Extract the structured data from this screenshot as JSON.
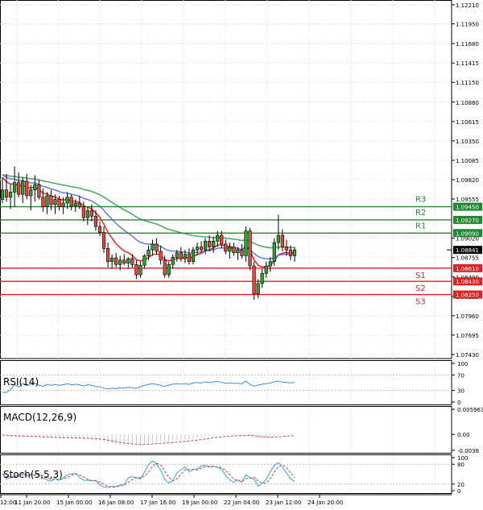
{
  "chart_data": {
    "type": "candlestick",
    "main": {
      "price_axis_labels": [
        "1.12210",
        "1.11950",
        "1.11680",
        "1.11415",
        "1.11150",
        "1.10880",
        "1.10615",
        "1.10350",
        "1.10085",
        "1.09820",
        "1.09555",
        "1.09020",
        "1.08755",
        "1.08490",
        "1.08225",
        "1.07960",
        "1.07695",
        "1.07430"
      ],
      "current_price": "1.08841",
      "levels": [
        {
          "name": "R3",
          "value": 1.0945,
          "label": "1.09450",
          "kind": "resistance"
        },
        {
          "name": "R2",
          "value": 1.0927,
          "label": "1.09270",
          "kind": "resistance"
        },
        {
          "name": "R1",
          "value": 1.0909,
          "label": "1.09090",
          "kind": "resistance"
        },
        {
          "name": "S1",
          "value": 1.0861,
          "label": "1.08610",
          "kind": "support"
        },
        {
          "name": "S2",
          "value": 1.0843,
          "label": "1.08430",
          "kind": "support"
        },
        {
          "name": "S3",
          "value": 1.0825,
          "label": "1.08250",
          "kind": "support"
        }
      ],
      "candles": [
        {
          "o": 1.0955,
          "h": 1.0985,
          "l": 1.095,
          "c": 1.0968
        },
        {
          "o": 1.0968,
          "h": 1.099,
          "l": 1.0952,
          "c": 1.0958
        },
        {
          "o": 1.0958,
          "h": 1.0975,
          "l": 1.0942,
          "c": 1.0965
        },
        {
          "o": 1.0965,
          "h": 1.1,
          "l": 1.0945,
          "c": 1.0978
        },
        {
          "o": 1.0978,
          "h": 1.0992,
          "l": 1.0958,
          "c": 1.0962
        },
        {
          "o": 1.0962,
          "h": 1.0985,
          "l": 1.095,
          "c": 1.098
        },
        {
          "o": 1.098,
          "h": 1.099,
          "l": 1.0955,
          "c": 1.096
        },
        {
          "o": 1.096,
          "h": 1.0975,
          "l": 1.094,
          "c": 1.0968
        },
        {
          "o": 1.0968,
          "h": 1.0988,
          "l": 1.0952,
          "c": 1.0975
        },
        {
          "o": 1.0975,
          "h": 1.0982,
          "l": 1.0955,
          "c": 1.0958
        },
        {
          "o": 1.0958,
          "h": 1.097,
          "l": 1.0938,
          "c": 1.0945
        },
        {
          "o": 1.0945,
          "h": 1.0965,
          "l": 1.0935,
          "c": 1.096
        },
        {
          "o": 1.096,
          "h": 1.0968,
          "l": 1.094,
          "c": 1.0948
        },
        {
          "o": 1.0948,
          "h": 1.0962,
          "l": 1.0935,
          "c": 1.0955
        },
        {
          "o": 1.0955,
          "h": 1.096,
          "l": 1.094,
          "c": 1.0945
        },
        {
          "o": 1.0945,
          "h": 1.0958,
          "l": 1.0935,
          "c": 1.095
        },
        {
          "o": 1.095,
          "h": 1.0965,
          "l": 1.0942,
          "c": 1.0958
        },
        {
          "o": 1.0958,
          "h": 1.0962,
          "l": 1.094,
          "c": 1.0946
        },
        {
          "o": 1.0946,
          "h": 1.0955,
          "l": 1.0938,
          "c": 1.095
        },
        {
          "o": 1.095,
          "h": 1.096,
          "l": 1.0942,
          "c": 1.0945
        },
        {
          "o": 1.0945,
          "h": 1.0952,
          "l": 1.0925,
          "c": 1.093
        },
        {
          "o": 1.093,
          "h": 1.0945,
          "l": 1.092,
          "c": 1.094
        },
        {
          "o": 1.094,
          "h": 1.0948,
          "l": 1.0925,
          "c": 1.0932
        },
        {
          "o": 1.0932,
          "h": 1.094,
          "l": 1.0912,
          "c": 1.0918
        },
        {
          "o": 1.0918,
          "h": 1.0925,
          "l": 1.0905,
          "c": 1.091
        },
        {
          "o": 1.091,
          "h": 1.0918,
          "l": 1.0882,
          "c": 1.0888
        },
        {
          "o": 1.0888,
          "h": 1.0896,
          "l": 1.0862,
          "c": 1.087
        },
        {
          "o": 1.087,
          "h": 1.088,
          "l": 1.086,
          "c": 1.0875
        },
        {
          "o": 1.0875,
          "h": 1.0882,
          "l": 1.0862,
          "c": 1.0866
        },
        {
          "o": 1.0866,
          "h": 1.0878,
          "l": 1.0858,
          "c": 1.0872
        },
        {
          "o": 1.0872,
          "h": 1.088,
          "l": 1.0865,
          "c": 1.0868
        },
        {
          "o": 1.0868,
          "h": 1.0876,
          "l": 1.086,
          "c": 1.0874
        },
        {
          "o": 1.0874,
          "h": 1.088,
          "l": 1.0862,
          "c": 1.0866
        },
        {
          "o": 1.0866,
          "h": 1.0872,
          "l": 1.0846,
          "c": 1.0852
        },
        {
          "o": 1.0852,
          "h": 1.087,
          "l": 1.0848,
          "c": 1.0865
        },
        {
          "o": 1.0865,
          "h": 1.088,
          "l": 1.086,
          "c": 1.0878
        },
        {
          "o": 1.0878,
          "h": 1.0892,
          "l": 1.0872,
          "c": 1.0886
        },
        {
          "o": 1.0886,
          "h": 1.09,
          "l": 1.0878,
          "c": 1.0894
        },
        {
          "o": 1.0894,
          "h": 1.0902,
          "l": 1.088,
          "c": 1.0884
        },
        {
          "o": 1.0884,
          "h": 1.0892,
          "l": 1.0866,
          "c": 1.0872
        },
        {
          "o": 1.0872,
          "h": 1.0878,
          "l": 1.0848,
          "c": 1.0852
        },
        {
          "o": 1.0852,
          "h": 1.087,
          "l": 1.0848,
          "c": 1.0866
        },
        {
          "o": 1.0866,
          "h": 1.088,
          "l": 1.086,
          "c": 1.0876
        },
        {
          "o": 1.0876,
          "h": 1.0886,
          "l": 1.087,
          "c": 1.0882
        },
        {
          "o": 1.0882,
          "h": 1.089,
          "l": 1.087,
          "c": 1.0874
        },
        {
          "o": 1.0874,
          "h": 1.0886,
          "l": 1.0868,
          "c": 1.088
        },
        {
          "o": 1.088,
          "h": 1.0888,
          "l": 1.0866,
          "c": 1.087
        },
        {
          "o": 1.087,
          "h": 1.089,
          "l": 1.0866,
          "c": 1.0886
        },
        {
          "o": 1.0886,
          "h": 1.0896,
          "l": 1.0878,
          "c": 1.089
        },
        {
          "o": 1.089,
          "h": 1.0898,
          "l": 1.0882,
          "c": 1.0886
        },
        {
          "o": 1.0886,
          "h": 1.0902,
          "l": 1.088,
          "c": 1.0898
        },
        {
          "o": 1.0898,
          "h": 1.0906,
          "l": 1.0884,
          "c": 1.089
        },
        {
          "o": 1.089,
          "h": 1.0904,
          "l": 1.0882,
          "c": 1.0898
        },
        {
          "o": 1.0898,
          "h": 1.0912,
          "l": 1.089,
          "c": 1.0906
        },
        {
          "o": 1.0906,
          "h": 1.0912,
          "l": 1.0888,
          "c": 1.0894
        },
        {
          "o": 1.0894,
          "h": 1.09,
          "l": 1.088,
          "c": 1.0884
        },
        {
          "o": 1.0884,
          "h": 1.0896,
          "l": 1.0874,
          "c": 1.089
        },
        {
          "o": 1.089,
          "h": 1.0896,
          "l": 1.0878,
          "c": 1.0882
        },
        {
          "o": 1.0882,
          "h": 1.089,
          "l": 1.0872,
          "c": 1.0886
        },
        {
          "o": 1.0886,
          "h": 1.0894,
          "l": 1.0874,
          "c": 1.0878
        },
        {
          "o": 1.0878,
          "h": 1.0918,
          "l": 1.087,
          "c": 1.0912
        },
        {
          "o": 1.0912,
          "h": 1.0916,
          "l": 1.0858,
          "c": 1.0864
        },
        {
          "o": 1.0864,
          "h": 1.087,
          "l": 1.0818,
          "c": 1.0826
        },
        {
          "o": 1.0826,
          "h": 1.0846,
          "l": 1.082,
          "c": 1.084
        },
        {
          "o": 1.084,
          "h": 1.086,
          "l": 1.0834,
          "c": 1.0854
        },
        {
          "o": 1.0854,
          "h": 1.087,
          "l": 1.0848,
          "c": 1.0864
        },
        {
          "o": 1.0864,
          "h": 1.0876,
          "l": 1.0856,
          "c": 1.087
        },
        {
          "o": 1.087,
          "h": 1.0902,
          "l": 1.0864,
          "c": 1.0896
        },
        {
          "o": 1.0896,
          "h": 1.0934,
          "l": 1.0886,
          "c": 1.0906
        },
        {
          "o": 1.0906,
          "h": 1.0914,
          "l": 1.0884,
          "c": 1.089
        },
        {
          "o": 1.089,
          "h": 1.09,
          "l": 1.0878,
          "c": 1.0886
        },
        {
          "o": 1.0886,
          "h": 1.0892,
          "l": 1.0872,
          "c": 1.0878
        },
        {
          "o": 1.0878,
          "h": 1.089,
          "l": 1.087,
          "c": 1.0886
        }
      ]
    },
    "time_labels": [
      "12:00",
      "11 Jan 20:00",
      "15 Jan 00:00",
      "16 Jan 08:00",
      "17 Jan 16:00",
      "19 Jan 00:00",
      "22 Jan 04:00",
      "23 Jan 12:00",
      "24 Jan 20:00"
    ],
    "rsi": {
      "title": "RSI(14)",
      "axis_labels": [
        "100",
        "70",
        "30",
        "0"
      ],
      "range": [
        0,
        100
      ],
      "levels": [
        70,
        30
      ]
    },
    "macd": {
      "title": "MACD(12,26,9)",
      "axis_labels": [
        "0.005963",
        "0.00",
        "-0.0038"
      ],
      "range": [
        -0.0038,
        0.005963
      ]
    },
    "stoch": {
      "title": "Stoch(5,5,3)",
      "axis_labels": [
        "100",
        "80",
        "20",
        "0"
      ],
      "range": [
        0,
        100
      ],
      "levels": [
        80,
        20
      ]
    },
    "colors": {
      "bull": "#2ca02c",
      "bear": "#e8453c",
      "resistance": "#1e8a2e",
      "support": "#e02020",
      "ma_fast": "#ee2222",
      "ma_mid": "#5b74e0",
      "ma_slow": "#4cae6a",
      "rsi": "#3a8fd8",
      "macd_signal": "#e04040",
      "stoch_main": "#39b0e0",
      "stoch_signal": "#e03a3a"
    }
  }
}
